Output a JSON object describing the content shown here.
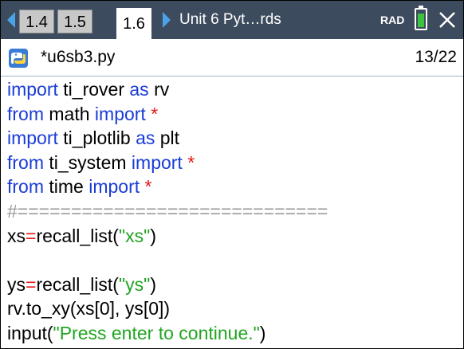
{
  "tabs": [
    {
      "label": "1.4",
      "active": false
    },
    {
      "label": "1.5",
      "active": false
    },
    {
      "label": "1.6",
      "active": true
    }
  ],
  "document_title": "Unit 6 Pyt…rds",
  "angle_mode": "RAD",
  "battery_level": 0.85,
  "colors": {
    "tabbar": "#3d4b5e",
    "arrow": "#4aa3e8",
    "keyword": "#1a3cd6",
    "operator": "#e21a1a",
    "string": "#21a521",
    "comment": "#9a9a9a",
    "battery": "#3cc43c"
  },
  "icons": {
    "left_arrow": "triangle-left",
    "right_arrow": "triangle-right",
    "file": "python-icon",
    "close": "close-icon",
    "battery": "battery-icon"
  },
  "editor": {
    "file_name": "*u6sb3.py",
    "position": "13/22",
    "lines": {
      "l1": {
        "kw1": "import",
        "t1": " ti_rover ",
        "kw2": "as",
        "t2": " rv"
      },
      "l2": {
        "kw1": "from",
        "t1": " math ",
        "kw2": "import",
        "t2": " ",
        "op": "*"
      },
      "l3": {
        "kw1": "import",
        "t1": " ti_plotlib ",
        "kw2": "as",
        "t2": " plt"
      },
      "l4": {
        "kw1": "from",
        "t1": " ti_system ",
        "kw2": "import",
        "t2": " ",
        "op": "*"
      },
      "l5": {
        "kw1": "from",
        "t1": " time ",
        "kw2": "import",
        "t2": " ",
        "op": "*"
      },
      "l6": {
        "comment": "#============================="
      },
      "l7": {
        "t1": "xs",
        "op": "=",
        "t2": "recall_list(",
        "str": "\"xs\"",
        "t3": ")"
      },
      "l8": {},
      "l9": {
        "t1": "ys",
        "op": "=",
        "t2": "recall_list(",
        "str": "\"ys\"",
        "t3": ")"
      },
      "l10": {
        "t1": "rv.to_xy(xs[0], ys[0])"
      },
      "l11": {
        "t1": "input(",
        "str": "\"Press enter to continue.\"",
        "t2": ")"
      }
    }
  }
}
